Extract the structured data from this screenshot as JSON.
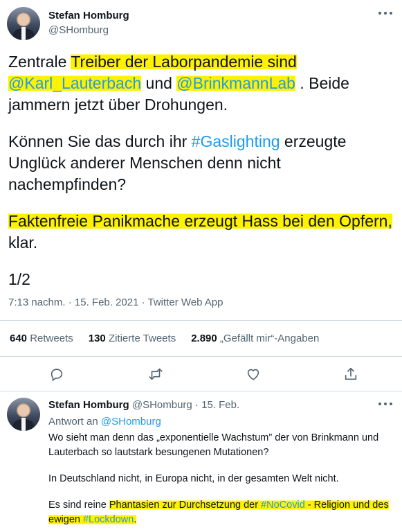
{
  "tweet": {
    "author_name": "Stefan Homburg",
    "author_handle": "@SHomburg",
    "p1_a": "Zentrale ",
    "p1_hl": "Treiber der Laborpandemie sind",
    "p1_b": " ",
    "mention1": "@Karl_Lauterbach",
    "p1_c": " und ",
    "mention2": "@BrinkmannLab",
    "p1_d": " . Beide jammern jetzt über Drohungen.",
    "p2_a": "Können Sie das durch ihr ",
    "hashtag1": "#Gaslighting",
    "p2_b": " erzeugte Unglück anderer Menschen denn nicht nachempfinden?",
    "p3_hl": "Faktenfreie Panikmache erzeugt Hass bei den Opfern,",
    "p3_b": " klar.",
    "p4": "1/2",
    "timestamp": "7:13 nachm. · 15. Feb. 2021 · Twitter Web App"
  },
  "stats": {
    "retweets_count": "640",
    "retweets_label": "Retweets",
    "quotes_count": "130",
    "quotes_label": "Zitierte Tweets",
    "likes_count": "2.890",
    "likes_label": "„Gefällt mir“-Angaben"
  },
  "actions": [
    "reply-icon",
    "retweet-icon",
    "like-icon",
    "share-icon"
  ],
  "reply": {
    "author_name": "Stefan Homburg",
    "handle_date": "@SHomburg · 15. Feb.",
    "replying_label": "Antwort an ",
    "replying_handle": "@SHomburg",
    "p1": "Wo sieht man denn das „exponentielle Wachstum” der von Brinkmann und Lauterbach so lautstark besungenen Mutationen?",
    "p2": "In Deutschland nicht, in Europa nicht, in der gesamten Welt nicht.",
    "p3_a": "Es sind reine ",
    "p3_hl1": "Phantasien zur Durchsetzung der ",
    "hashtag_nocovid": "#NoCovid",
    "p3_hl2": " - Religion und des ewigen ",
    "hashtag_lockdown": "#Lockdown",
    "p3_end": "."
  },
  "colors": {
    "link": "#1d9bf0",
    "highlight": "#fff200",
    "muted": "#536471"
  }
}
